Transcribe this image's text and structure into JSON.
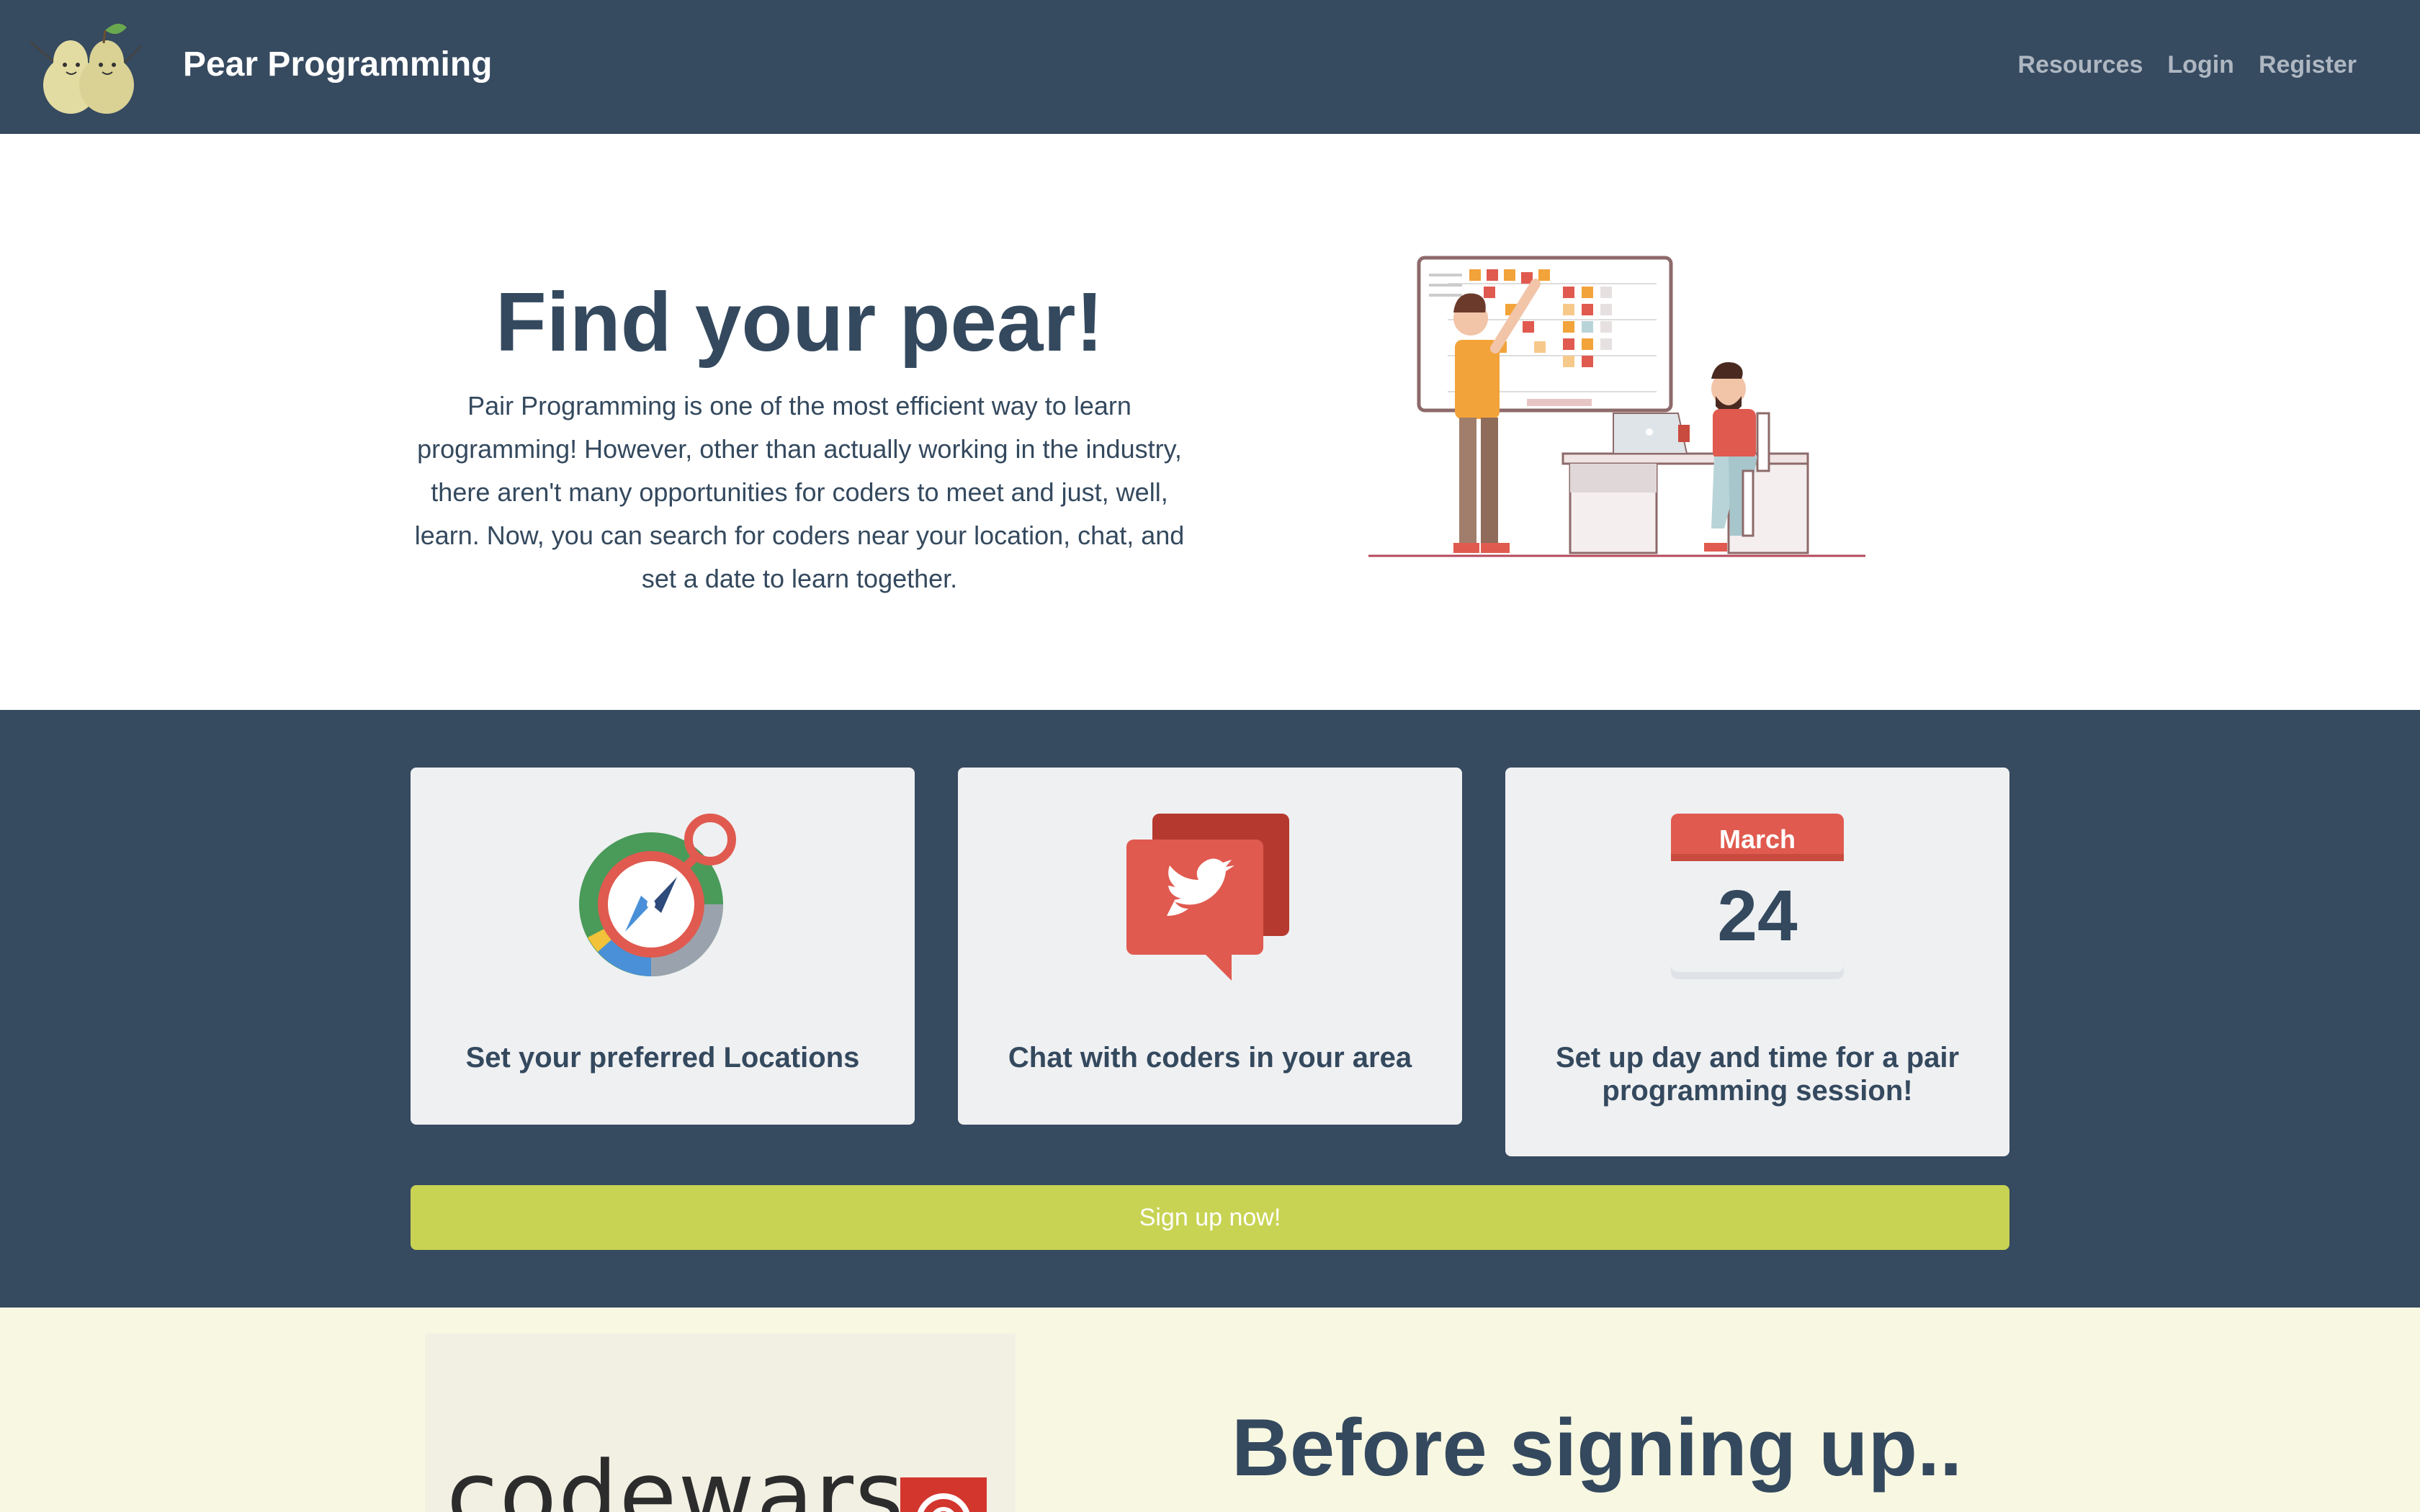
{
  "navbar": {
    "brand": "Pear Programming",
    "links": [
      "Resources",
      "Login",
      "Register"
    ]
  },
  "hero": {
    "title": "Find your pear!",
    "description": "Pair Programming is one of the most efficient way to learn programming! However, other than actually working in the industry, there aren't many opportunities for coders to meet and just, well, learn. Now, you can search for coders near your location, chat, and set a date to learn together."
  },
  "features": {
    "cards": [
      {
        "icon": "compass-icon",
        "caption": "Set your preferred Locations"
      },
      {
        "icon": "chat-bird-icon",
        "caption": "Chat with coders in your area"
      },
      {
        "icon": "calendar-icon",
        "caption": "Set up day and time for a pair programming session!",
        "calendar_month": "March",
        "calendar_day": "24"
      }
    ],
    "signup_label": "Sign up now!"
  },
  "before": {
    "title": "Before signing up..",
    "image_text": "codewars"
  },
  "colors": {
    "navbar": "#364a60",
    "text_dark": "#34495e",
    "card_bg": "#eff0f2",
    "signup": "#c8d353",
    "before_bg": "#f8f8e2"
  }
}
